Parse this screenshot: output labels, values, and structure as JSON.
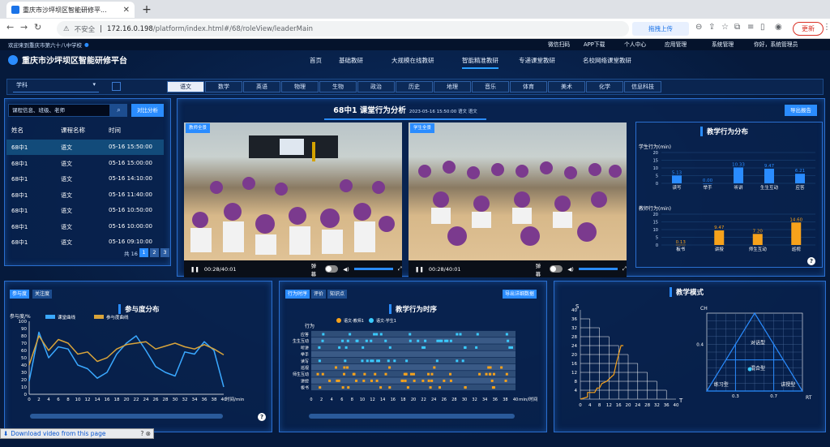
{
  "browser": {
    "tab_title": "重庆市沙坪坝区智能研修平...",
    "security_label": "不安全",
    "url_host": "172.16.0.198",
    "url_path": "/platform/index.html#/68/roleView/leaderMain",
    "upload_label": "拖拽上传",
    "update_label": "更新"
  },
  "topbar": {
    "welcome": "欢迎来到重庆市第六十八中学校",
    "menu": [
      "微信扫码",
      "APP下载",
      "个人中心",
      "应用管理",
      "系统管理"
    ],
    "greeting": "你好，系统管理员"
  },
  "header": {
    "brand": "重庆市沙坪坝区智能研修平台",
    "nav": [
      "首页",
      "基础教研",
      "大规模在线教研",
      "智能精准教研",
      "专递课堂教研",
      "名校网络课堂教研"
    ],
    "active_nav": "智能精准教研"
  },
  "filters": {
    "subject_select": "学科",
    "subjects": [
      "语文",
      "数学",
      "英语",
      "物理",
      "生物",
      "政治",
      "历史",
      "地理",
      "音乐",
      "体育",
      "美术",
      "化学",
      "信息科技"
    ],
    "active_subject": "语文"
  },
  "lesson_list": {
    "search_placeholder": "课程信息、班级、老师",
    "compare_button": "对比分析",
    "columns": [
      "姓名",
      "课程名称",
      "时间"
    ],
    "rows": [
      [
        "68中1",
        "语文",
        "05-16 15:50:00"
      ],
      [
        "68中1",
        "语文",
        "05-16 15:00:00"
      ],
      [
        "68中1",
        "语文",
        "05-16 14:10:00"
      ],
      [
        "68中1",
        "语文",
        "05-16 11:40:00"
      ],
      [
        "68中1",
        "语文",
        "05-16 10:50:00"
      ],
      [
        "68中1",
        "语文",
        "05-16 10:00:00"
      ],
      [
        "68中1",
        "语文",
        "05-16 09:10:00"
      ]
    ],
    "total": "共 16 条",
    "pages": [
      "1",
      "2",
      "3"
    ],
    "current_page": "1"
  },
  "analysis": {
    "title": "68中1 课堂行为分析",
    "subtitle": "2023-05-16 15:50:00 语文 语文",
    "export_button": "导出报告",
    "teacher_tag": "教师全景",
    "student_tag": "学生全景",
    "time_display": "00:28/40:01",
    "danmu_label": "弹幕"
  },
  "behavior_dist": {
    "title": "教学行为分布",
    "student_chart": {
      "ylabel": "学生行为(min)",
      "categories": [
        "读写",
        "举手",
        "听讲",
        "生生互动",
        "应答"
      ],
      "values": [
        5.13,
        0.0,
        10.33,
        9.47,
        6.21
      ],
      "labels": [
        "5.13",
        "0.00",
        "10.33",
        "9.47",
        "6.21"
      ],
      "ylim": [
        0,
        20
      ],
      "color": "#2a8cff"
    },
    "teacher_chart": {
      "ylabel": "教师行为(min)",
      "categories": [
        "板书",
        "讲授",
        "师生互动",
        "巡视"
      ],
      "values": [
        0.13,
        9.47,
        7.2,
        14.6
      ],
      "labels": [
        "0.13",
        "9.47",
        "7.20",
        "14.60"
      ],
      "ylim": [
        0,
        20
      ],
      "color": "#f7a21b"
    }
  },
  "participation": {
    "tabs": [
      "参与度",
      "关注度"
    ],
    "title": "参与度分布",
    "ylabel": "参与度/%",
    "xlabel": "时间/min",
    "legend": [
      "课堂曲线",
      "参与度曲线"
    ],
    "chart_data": {
      "type": "line",
      "x": [
        0,
        2,
        4,
        6,
        8,
        10,
        12,
        14,
        16,
        18,
        20,
        22,
        24,
        26,
        28,
        30,
        32,
        34,
        36,
        38,
        40
      ],
      "xlim": [
        0,
        40
      ],
      "ylim": [
        0,
        100
      ],
      "series": [
        {
          "name": "课堂曲线",
          "color": "#3aa8ff",
          "values": [
            18,
            85,
            50,
            65,
            62,
            40,
            35,
            22,
            30,
            55,
            70,
            80,
            60,
            38,
            30,
            25,
            58,
            55,
            72,
            60,
            10
          ]
        },
        {
          "name": "参与度曲线",
          "color": "#d9a43a",
          "values": [
            40,
            80,
            60,
            75,
            70,
            55,
            58,
            45,
            50,
            62,
            68,
            70,
            72,
            62,
            66,
            70,
            65,
            62,
            68,
            62,
            54
          ]
        }
      ]
    }
  },
  "timeline": {
    "tabs": [
      "行为时序",
      "评价",
      "知识点"
    ],
    "export_button": "导出详细数据",
    "title": "教学行为时序",
    "legend": [
      "语文-教师1",
      "语文-学生1"
    ],
    "y_title": "行为",
    "rows": [
      "应答",
      "生生互动",
      "听讲",
      "举手",
      "读写",
      "巡视",
      "师生互动",
      "讲授",
      "板书"
    ],
    "xticks": [
      "0",
      "2",
      "4",
      "6",
      "8",
      "10",
      "12",
      "14",
      "16",
      "18",
      "20",
      "22",
      "24",
      "26",
      "28",
      "30",
      "32",
      "34",
      "36",
      "38",
      "40"
    ],
    "xlabel": "min/时间"
  },
  "teaching_mode": {
    "title": "教学模式",
    "st_chart": {
      "ylabel": "S",
      "xlabel": "T",
      "ticks": [
        "0",
        "4",
        "8",
        "12",
        "16",
        "20",
        "24",
        "28",
        "32",
        "36",
        "40"
      ],
      "yticks": [
        "4",
        "8",
        "12",
        "16",
        "20",
        "24",
        "28",
        "32",
        "36",
        "40"
      ]
    },
    "rt_chart": {
      "ylabel": "CH",
      "xlabel": "RT",
      "ytick": "0.4",
      "xticks": [
        "0.3",
        "0.7"
      ],
      "regions": [
        "对话型",
        "混合型",
        "练习型",
        "讲授型"
      ],
      "point_rt": 0.45,
      "point_ch": 0.4
    }
  },
  "download_bar": {
    "label": "Download video from this page"
  }
}
